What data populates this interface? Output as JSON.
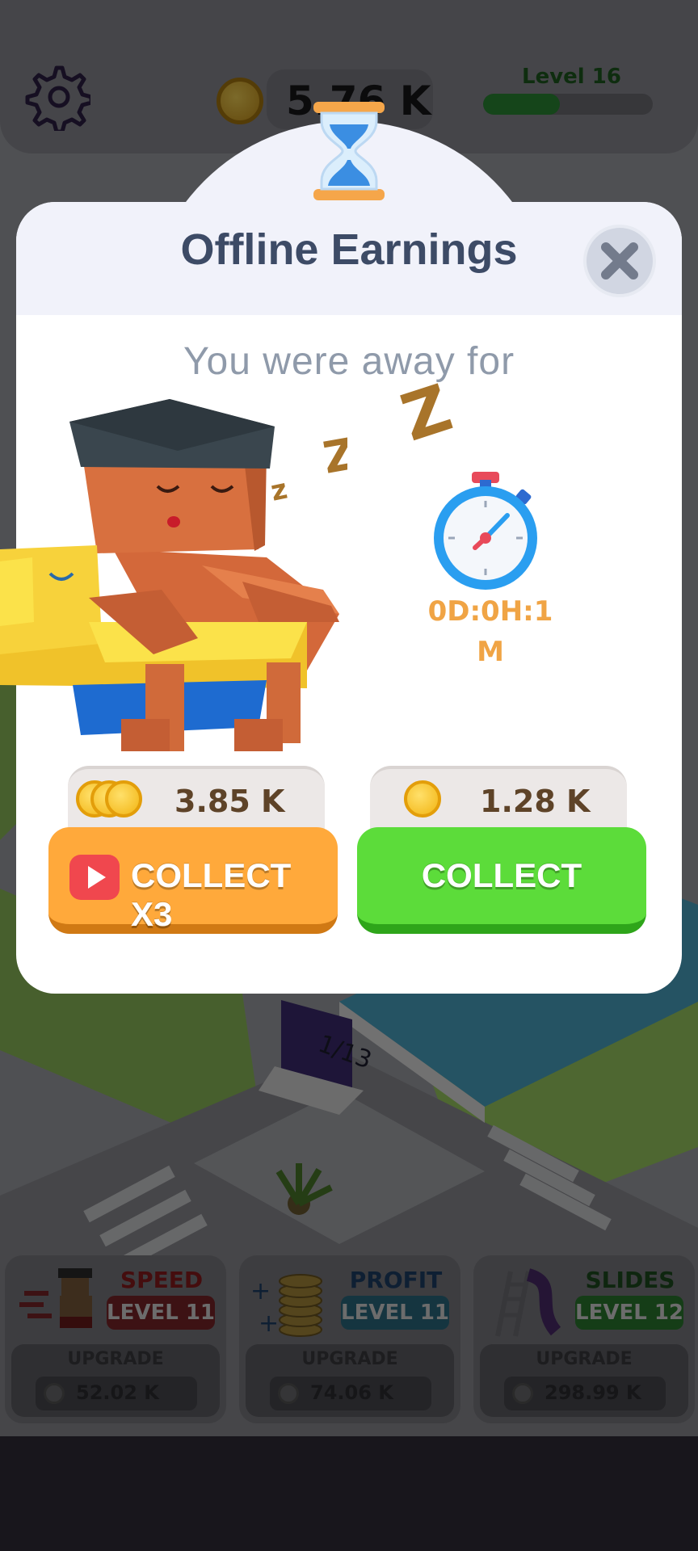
{
  "hud": {
    "money": "5.76 K",
    "level_label": "Level 16",
    "level_progress": 0.45
  },
  "popup": {
    "title": "Offline Earnings",
    "subtitle": "You were away for",
    "timer": "0D:0H:1M",
    "reward_triple": "3.85 K",
    "reward_single": "1.28 K",
    "collect_x3_label": "COLLECT X3",
    "collect_label": "COLLECT"
  },
  "scene": {
    "pool_sign": "1/13"
  },
  "upgrades": [
    {
      "title": "SPEED",
      "level": "LEVEL 11",
      "upgrade_label": "UPGRADE",
      "price": "52.02 K",
      "title_color": "#8a1a1c",
      "level_color": "#7a2528"
    },
    {
      "title": "PROFIT",
      "level": "LEVEL 11",
      "upgrade_label": "UPGRADE",
      "price": "74.06 K",
      "title_color": "#1d3f66",
      "level_color": "#2b6a80"
    },
    {
      "title": "SLIDES",
      "level": "LEVEL 12",
      "upgrade_label": "UPGRADE",
      "price": "298.99 K",
      "title_color": "#1d4d1e",
      "level_color": "#2b7a2e"
    }
  ],
  "colors": {
    "collect_orange": "#ffa93b",
    "collect_green": "#5cdc3a",
    "timer_orange": "#f0a445",
    "title_navy": "#3d4b66"
  }
}
